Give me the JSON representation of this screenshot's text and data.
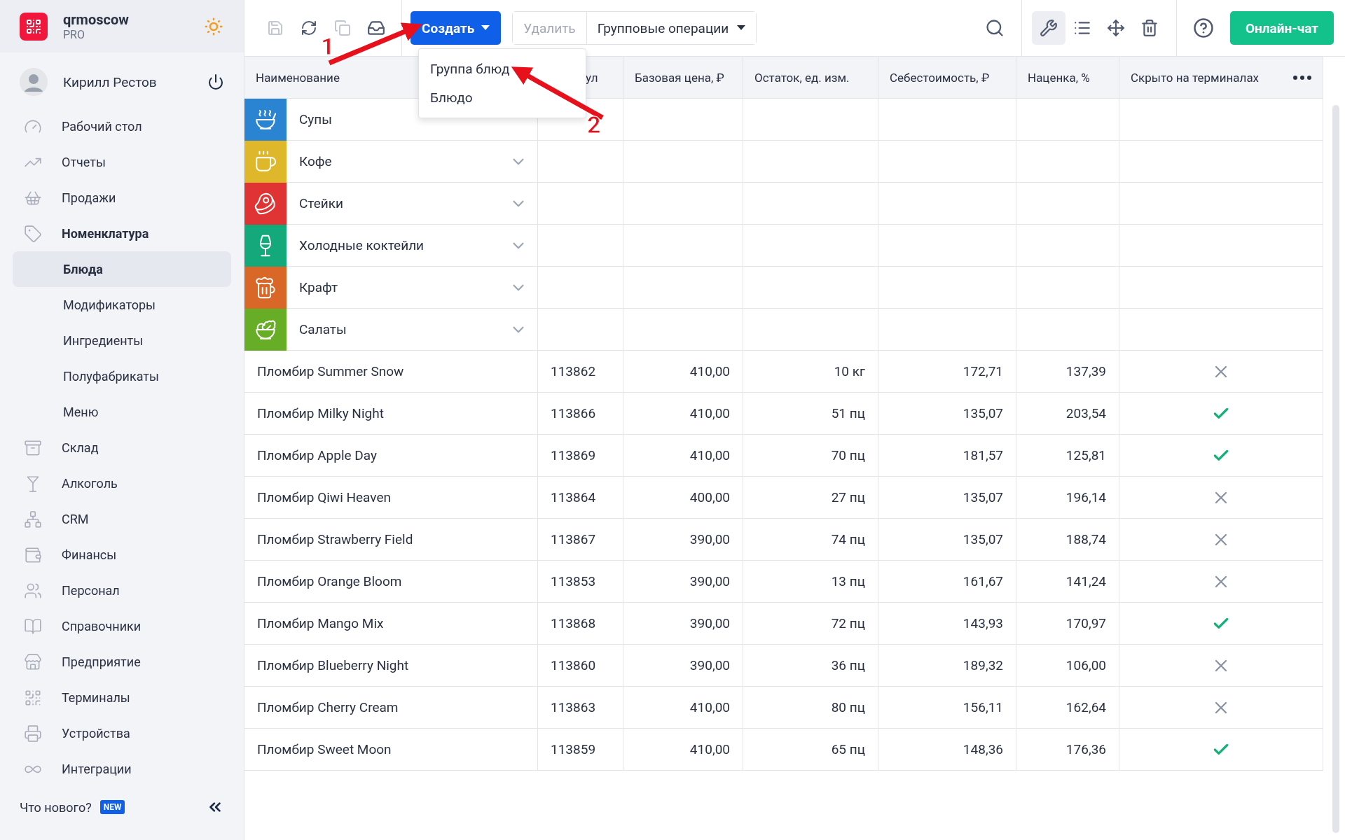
{
  "brand": {
    "name": "qrmoscow",
    "plan": "PRO"
  },
  "user": {
    "name": "Кирилл Рестов"
  },
  "sidebar": {
    "items": [
      {
        "label": "Рабочий стол",
        "kind": "section",
        "selected": false
      },
      {
        "label": "Отчеты",
        "kind": "section",
        "selected": false
      },
      {
        "label": "Продажи",
        "kind": "section",
        "selected": false
      },
      {
        "label": "Номенклатура",
        "kind": "section",
        "selected": true
      },
      {
        "label": "Блюда",
        "kind": "sub",
        "selected": true
      },
      {
        "label": "Модификаторы",
        "kind": "sub",
        "selected": false
      },
      {
        "label": "Ингредиенты",
        "kind": "sub",
        "selected": false
      },
      {
        "label": "Полуфабрикаты",
        "kind": "sub",
        "selected": false
      },
      {
        "label": "Меню",
        "kind": "sub",
        "selected": false
      },
      {
        "label": "Склад",
        "kind": "section",
        "selected": false
      },
      {
        "label": "Алкоголь",
        "kind": "section",
        "selected": false
      },
      {
        "label": "CRM",
        "kind": "section",
        "selected": false
      },
      {
        "label": "Финансы",
        "kind": "section",
        "selected": false
      },
      {
        "label": "Персонал",
        "kind": "section",
        "selected": false
      },
      {
        "label": "Справочники",
        "kind": "section",
        "selected": false
      },
      {
        "label": "Предприятие",
        "kind": "section",
        "selected": false
      },
      {
        "label": "Терминалы",
        "kind": "section",
        "selected": false
      },
      {
        "label": "Устройства",
        "kind": "section",
        "selected": false
      },
      {
        "label": "Интеграции",
        "kind": "section",
        "selected": false
      }
    ],
    "whats_new": "Что нового?",
    "badge": "NEW"
  },
  "toolbar": {
    "create": "Создать",
    "delete": "Удалить",
    "group_ops": "Групповые операции",
    "chat": "Онлайн-чат"
  },
  "create_menu": [
    "Группа блюд",
    "Блюдо"
  ],
  "annotations": [
    {
      "label": "1"
    },
    {
      "label": "2"
    }
  ],
  "table": {
    "columns": [
      "Наименование",
      "ул",
      "Базовая цена, ₽",
      "Остаток, ед. изм.",
      "Себестоимость, ₽",
      "Наценка, %",
      "Скрыто на терминалах"
    ],
    "groups": [
      {
        "name": "Супы",
        "color": "#2a84d2",
        "collapsible": false
      },
      {
        "name": "Кофе",
        "color": "#dfb72a",
        "collapsible": true
      },
      {
        "name": "Стейки",
        "color": "#e03434",
        "collapsible": true
      },
      {
        "name": "Холодные коктейли",
        "color": "#14a97a",
        "collapsible": true
      },
      {
        "name": "Крафт",
        "color": "#d96727",
        "collapsible": true
      },
      {
        "name": "Салаты",
        "color": "#67ad26",
        "collapsible": true
      }
    ],
    "rows": [
      {
        "name": "Пломбир Summer Snow",
        "sku": "113862",
        "price": "410,00",
        "stock": "10 кг",
        "cost": "172,71",
        "markup": "137,39",
        "hidden": false
      },
      {
        "name": "Пломбир Milky Night",
        "sku": "113866",
        "price": "410,00",
        "stock": "51 пц",
        "cost": "135,07",
        "markup": "203,54",
        "hidden": true
      },
      {
        "name": "Пломбир Apple Day",
        "sku": "113869",
        "price": "410,00",
        "stock": "70 пц",
        "cost": "181,57",
        "markup": "125,81",
        "hidden": true
      },
      {
        "name": "Пломбир Qiwi Heaven",
        "sku": "113864",
        "price": "400,00",
        "stock": "27 пц",
        "cost": "135,07",
        "markup": "196,14",
        "hidden": false
      },
      {
        "name": "Пломбир Strawberry Field",
        "sku": "113867",
        "price": "390,00",
        "stock": "74 пц",
        "cost": "135,07",
        "markup": "188,74",
        "hidden": false
      },
      {
        "name": "Пломбир Orange Bloom",
        "sku": "113853",
        "price": "390,00",
        "stock": "13 пц",
        "cost": "161,67",
        "markup": "141,24",
        "hidden": false
      },
      {
        "name": "Пломбир Mango Mix",
        "sku": "113868",
        "price": "390,00",
        "stock": "72 пц",
        "cost": "143,93",
        "markup": "170,97",
        "hidden": true
      },
      {
        "name": "Пломбир Blueberry Night",
        "sku": "113860",
        "price": "390,00",
        "stock": "36 пц",
        "cost": "189,32",
        "markup": "106,00",
        "hidden": false
      },
      {
        "name": "Пломбир Cherry Cream",
        "sku": "113863",
        "price": "410,00",
        "stock": "80 пц",
        "cost": "156,11",
        "markup": "162,64",
        "hidden": false
      },
      {
        "name": "Пломбир Sweet Moon",
        "sku": "113859",
        "price": "410,00",
        "stock": "65 пц",
        "cost": "148,36",
        "markup": "176,36",
        "hidden": true
      }
    ]
  }
}
